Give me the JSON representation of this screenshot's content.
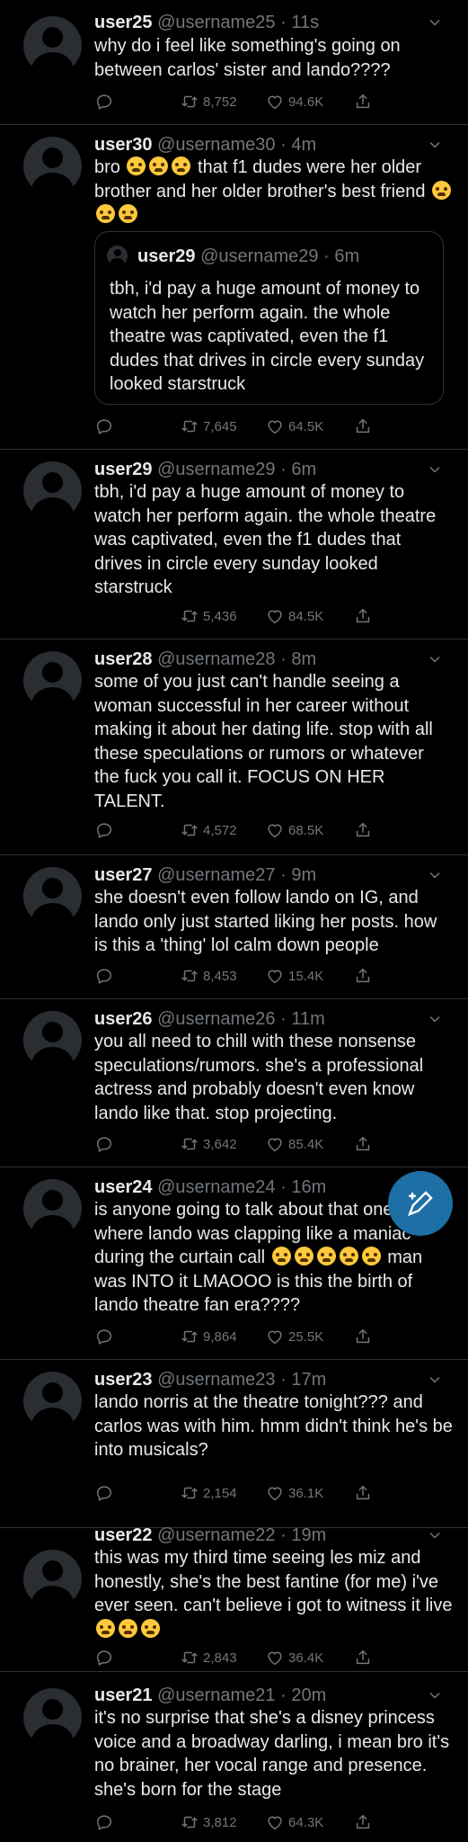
{
  "icons": {
    "reply": "reply-icon",
    "retweet": "retweet-icon",
    "like": "heart-icon",
    "share": "share-icon",
    "more": "chevron-down-icon",
    "compose": "compose-tweet-icon"
  },
  "colors": {
    "background": "#000000",
    "text": "#e7e9ea",
    "muted": "#71767b",
    "divider": "#2f3336",
    "compose_button": "#1d6fa5"
  },
  "tweets": [
    {
      "user": "user25",
      "handle": "@username25",
      "time": "11s",
      "text": "why do i feel like something's going on between carlos' sister and lando????",
      "retweets": "8,752",
      "likes": "94.6K"
    },
    {
      "user": "user30",
      "handle": "@username30",
      "time": "4m",
      "text_a": "bro ",
      "text_b": " that f1 dudes were her older brother and her older brother's best friend ",
      "retweets": "7,645",
      "likes": "64.5K",
      "quote": {
        "user": "user29",
        "handle": "@username29",
        "time": "6m",
        "text": "tbh, i'd pay a huge amount of money to watch her perform again. the whole theatre was captivated, even the f1 dudes that drives in circle every sunday looked starstruck"
      }
    },
    {
      "user": "user29",
      "handle": "@username29",
      "time": "6m",
      "text": "tbh, i'd pay a huge amount of money to watch her perform again. the whole theatre was captivated, even the f1 dudes that drives in circle every sunday looked starstruck",
      "retweets": "5,436",
      "likes": "84.5K"
    },
    {
      "user": "user28",
      "handle": "@username28",
      "time": "8m",
      "text": "some of you just can't handle seeing a woman successful in her career without making it about her dating life. stop with all these speculations or rumors or whatever the fuck you call it. FOCUS ON HER TALENT.",
      "retweets": "4,572",
      "likes": "68.5K"
    },
    {
      "user": "user27",
      "handle": "@username27",
      "time": "9m",
      "text": "she doesn't even follow lando on IG, and lando only just started liking her posts. how is this a 'thing' lol calm down people",
      "retweets": "8,453",
      "likes": "15.4K"
    },
    {
      "user": "user26",
      "handle": "@username26",
      "time": "11m",
      "text": "you all need to chill with these nonsense speculations/rumors. she's a professional actress and probably doesn't even know lando like that. stop projecting.",
      "retweets": "3,642",
      "likes": "85.4K"
    },
    {
      "user": "user24",
      "handle": "@username24",
      "time": "16m",
      "text_a": "is anyone going to talk about that one clip where lando was clapping like a maniac during the curtain call ",
      "text_b": " man was INTO it LMAOOO is this the birth of lando theatre fan era????",
      "retweets": "9,864",
      "likes": "25.5K"
    },
    {
      "user": "user23",
      "handle": "@username23",
      "time": "17m",
      "text": "lando norris at the theatre tonight??? and carlos was with him. hmm didn't think he's be into musicals?",
      "retweets": "2,154",
      "likes": "36.1K"
    },
    {
      "user": "user22",
      "handle": "@username22",
      "time": "19m",
      "text_a": "this was my third time seeing les miz and honestly, she's the best fantine (for me) i've ever seen. can't believe i got to witness it live ",
      "retweets": "2,843",
      "likes": "36.4K"
    },
    {
      "user": "user21",
      "handle": "@username21",
      "time": "20m",
      "text": "it's no surprise that she's a disney princess voice and a broadway darling, i mean bro it's no brainer, her vocal range and presence. she's born for the stage",
      "retweets": "3,812",
      "likes": "64.3K"
    }
  ]
}
